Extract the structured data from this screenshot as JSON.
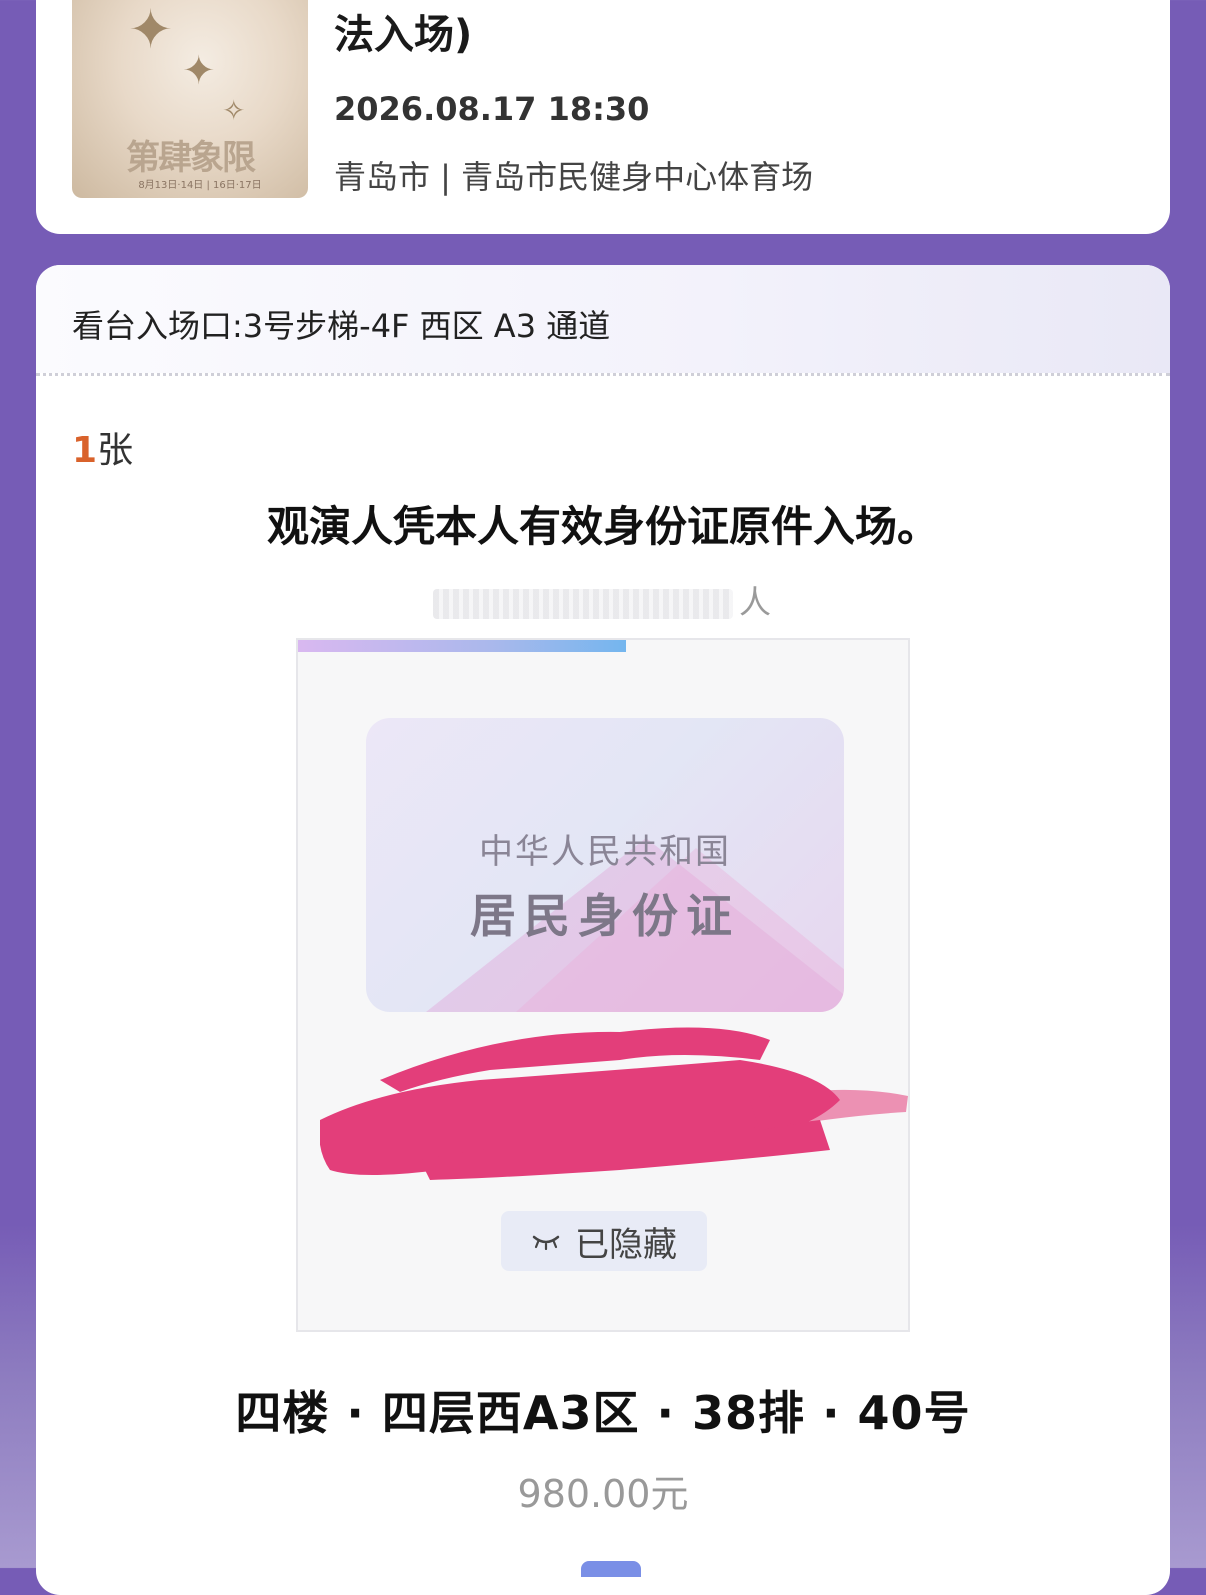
{
  "event": {
    "title_tail": "法入场)",
    "datetime": "2026.08.17 18:30",
    "venue": "青岛市 | 青岛市民健身中心体育场",
    "poster": {
      "title": "第肆象限",
      "dates": "8月13日·14日 | 16日·17日"
    }
  },
  "ticket": {
    "entrance": "看台入场口:3号步梯-4F 西区 A3 通道",
    "count_num": "1",
    "count_unit": "张",
    "id_notice": "观演人凭本人有效身份证原件入场。",
    "holder_suffix": "人",
    "id_card": {
      "country": "中华人民共和国",
      "type": "居民身份证"
    },
    "hidden_label": "已隐藏",
    "seat": "四楼 · 四层西A3区 · 38排 · 40号",
    "price": "980.00元"
  },
  "colors": {
    "background": "#765cb6",
    "count_accent": "#d9622b",
    "scribble": "#e33e7a"
  }
}
